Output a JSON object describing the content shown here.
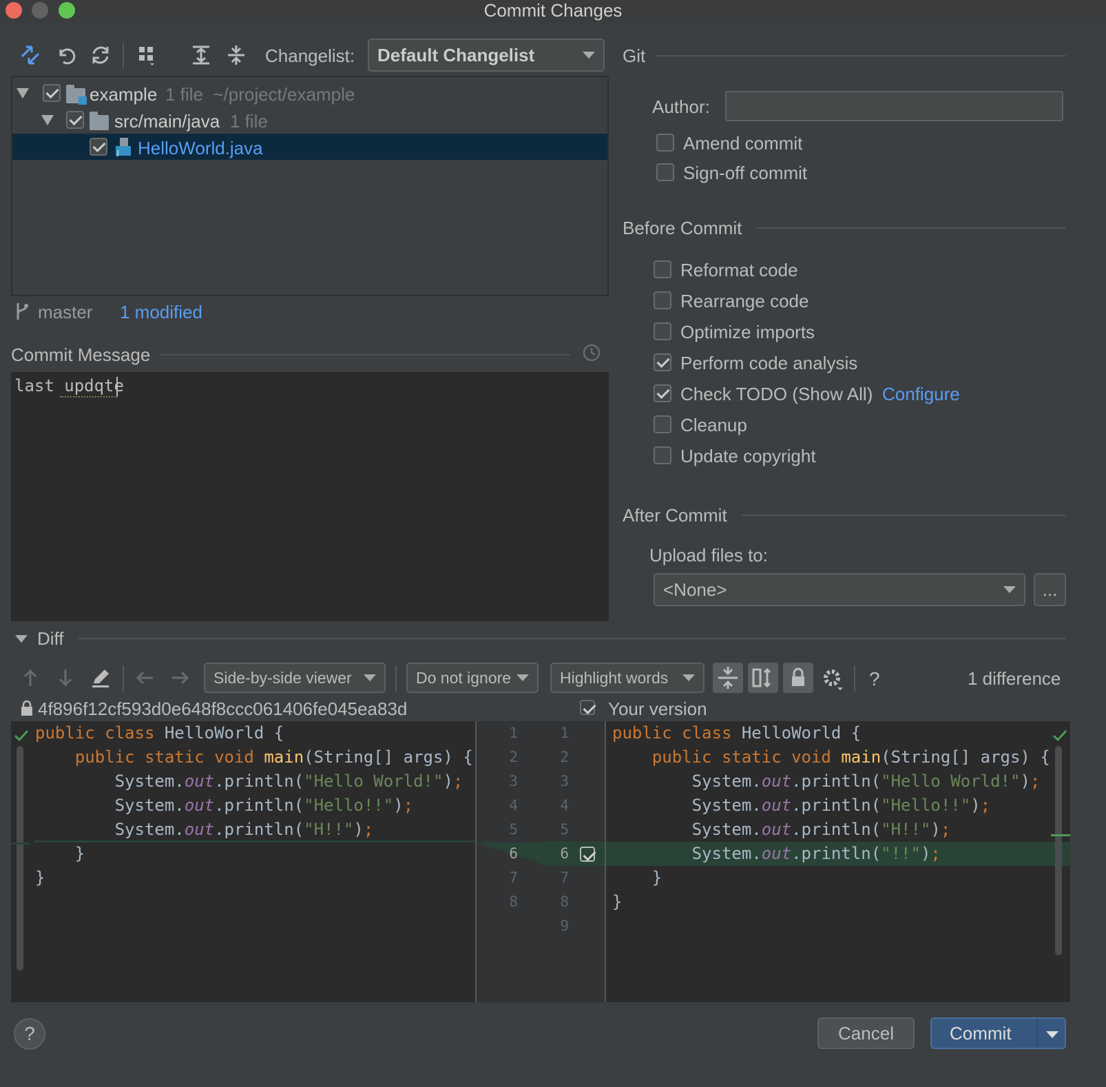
{
  "window": {
    "title": "Commit Changes"
  },
  "toolbar": {
    "changelist_label": "Changelist:",
    "changelist_value": "Default Changelist"
  },
  "tree": {
    "root": {
      "name": "example",
      "meta": "1 file  ~/project/example"
    },
    "folder": {
      "name": "src/main/java",
      "meta": "1 file"
    },
    "file": {
      "name": "HelloWorld.java"
    }
  },
  "status": {
    "branch": "master",
    "modified": "1 modified"
  },
  "commit_message": {
    "title": "Commit Message",
    "text": "last updqte"
  },
  "git": {
    "title": "Git",
    "author_label": "Author:",
    "author_value": "",
    "amend": "Amend commit",
    "signoff": "Sign-off commit"
  },
  "before_commit": {
    "title": "Before Commit",
    "items": [
      {
        "label": "Reformat code",
        "checked": false
      },
      {
        "label": "Rearrange code",
        "checked": false
      },
      {
        "label": "Optimize imports",
        "checked": false
      },
      {
        "label": "Perform code analysis",
        "checked": true
      },
      {
        "label": "Check TODO (Show All)",
        "checked": true
      },
      {
        "label": "Cleanup",
        "checked": false
      },
      {
        "label": "Update copyright",
        "checked": false
      }
    ],
    "configure_link": "Configure"
  },
  "after_commit": {
    "title": "After Commit",
    "upload_label": "Upload files to:",
    "upload_value": "<None>",
    "browse": "..."
  },
  "diff": {
    "title": "Diff",
    "viewer": "Side-by-side viewer",
    "ignore": "Do not ignore",
    "highlight": "Highlight words",
    "help": "?",
    "differences": "1 difference",
    "left_header": "4f896f12cf593d0e648f8ccc061406fe045ea83d",
    "right_header": "Your version",
    "left_numbers": [
      "1",
      "2",
      "3",
      "4",
      "5",
      "6",
      "7",
      "8"
    ],
    "right_numbers": [
      "1",
      "2",
      "3",
      "4",
      "5",
      "6",
      "7",
      "8",
      "9"
    ]
  },
  "buttons": {
    "help": "?",
    "cancel": "Cancel",
    "commit": "Commit"
  },
  "colors": {
    "accent": "#365880",
    "selection": "#0d293e",
    "link": "#589df6",
    "added": "#294436"
  }
}
